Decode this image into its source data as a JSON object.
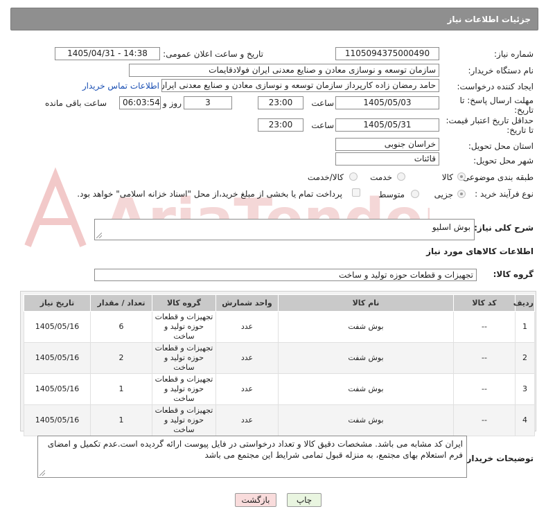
{
  "header": {
    "title": "جزئیات اطلاعات نیاز"
  },
  "fields": {
    "need_number_label": "شماره نیاز:",
    "need_number": "1105094375000490",
    "announce_label": "تاریخ و ساعت اعلان عمومی:",
    "announce_value": "1405/04/31 - 14:38",
    "buyer_label": "نام دستگاه خریدار:",
    "buyer_value": "سازمان توسعه و نوسازی معادن و صنایع معدنی ایران فولادقایمات",
    "creator_label": "ایجاد کننده درخواست:",
    "creator_value": "حامد  رمضان زاده  کارپرداز  سازمان توسعه و نوسازی معادن و صنایع معدنی ایران",
    "contact_link": "اطلاعات تماس خریدار",
    "deadline_label_1": "مهلت ارسال پاسخ: تا",
    "deadline_label_2": "تاریخ:",
    "deadline_date": "1405/05/03",
    "time_label": "ساعت",
    "deadline_time": "23:00",
    "days_value": "3",
    "days_label": "روز و",
    "remaining_time": "06:03:54",
    "remaining_label": "ساعت باقی مانده",
    "min_price_label_1": "حداقل تاریخ اعتبار قیمت:",
    "min_price_label_2": "تا تاریخ:",
    "price_date": "1405/05/31",
    "price_time": "23:00",
    "province_label": "استان محل تحویل:",
    "province_value": "خراسان جنوبی",
    "city_label": "شهر محل تحویل:",
    "city_value": "قائنات",
    "category_label": "طبقه بندی موضوعی:",
    "category_goods": "کالا",
    "category_service": "خدمت",
    "category_both": "کالا/خدمت",
    "process_label": "نوع فرآیند خرید :",
    "process_partial": "جزیی",
    "process_medium": "متوسط",
    "treasury_note": "پرداخت تمام یا بخشی از مبلغ خرید،از محل \"اسناد خزانه اسلامی\" خواهد بود."
  },
  "summary": {
    "label": "شرح کلی نیاز:",
    "value": "بوش اسلیو"
  },
  "goods_info_title": "اطلاعات کالاهای مورد نیاز",
  "goods_group": {
    "label": "گروه کالا:",
    "value": "تجهیزات و قطعات حوزه تولید و ساخت"
  },
  "table": {
    "headers": [
      "ردیف",
      "کد کالا",
      "نام کالا",
      "واحد شمارش",
      "گروه کالا",
      "تعداد / مقدار",
      "تاریخ نیاز"
    ],
    "rows": [
      {
        "row": "1",
        "code": "--",
        "name": "بوش شفت",
        "unit": "عدد",
        "group": "تجهیزات و قطعات حوزه تولید و ساخت",
        "qty": "6",
        "date": "1405/05/16"
      },
      {
        "row": "2",
        "code": "--",
        "name": "بوش شفت",
        "unit": "عدد",
        "group": "تجهیزات و قطعات حوزه تولید و ساخت",
        "qty": "2",
        "date": "1405/05/16"
      },
      {
        "row": "3",
        "code": "--",
        "name": "بوش شفت",
        "unit": "عدد",
        "group": "تجهیزات و قطعات حوزه تولید و ساخت",
        "qty": "1",
        "date": "1405/05/16"
      },
      {
        "row": "4",
        "code": "--",
        "name": "بوش شفت",
        "unit": "عدد",
        "group": "تجهیزات و قطعات حوزه تولید و ساخت",
        "qty": "1",
        "date": "1405/05/16"
      }
    ]
  },
  "buyer_notes": {
    "label": "توضیحات خریدار:",
    "value": "ایران کد مشابه می باشد. مشخصات دقیق کالا و تعداد درخواستی در فایل پیوست ارائه گردیده است.عدم تکمیل و امضای فرم استعلام بهای مجتمع، به منزله قبول تمامی شرایط این مجتمع می باشد"
  },
  "buttons": {
    "print": "چاپ",
    "back": "بازگشت"
  },
  "watermark": "AriaTender.neT",
  "colors": {
    "header_bg": "#8f8f8f",
    "link": "#1a4fb3",
    "back_button_bg": "#f9dcdc",
    "print_button_bg": "#e9f5e0"
  },
  "icons": {
    "watermark_logo": "aria-tender-logo"
  }
}
